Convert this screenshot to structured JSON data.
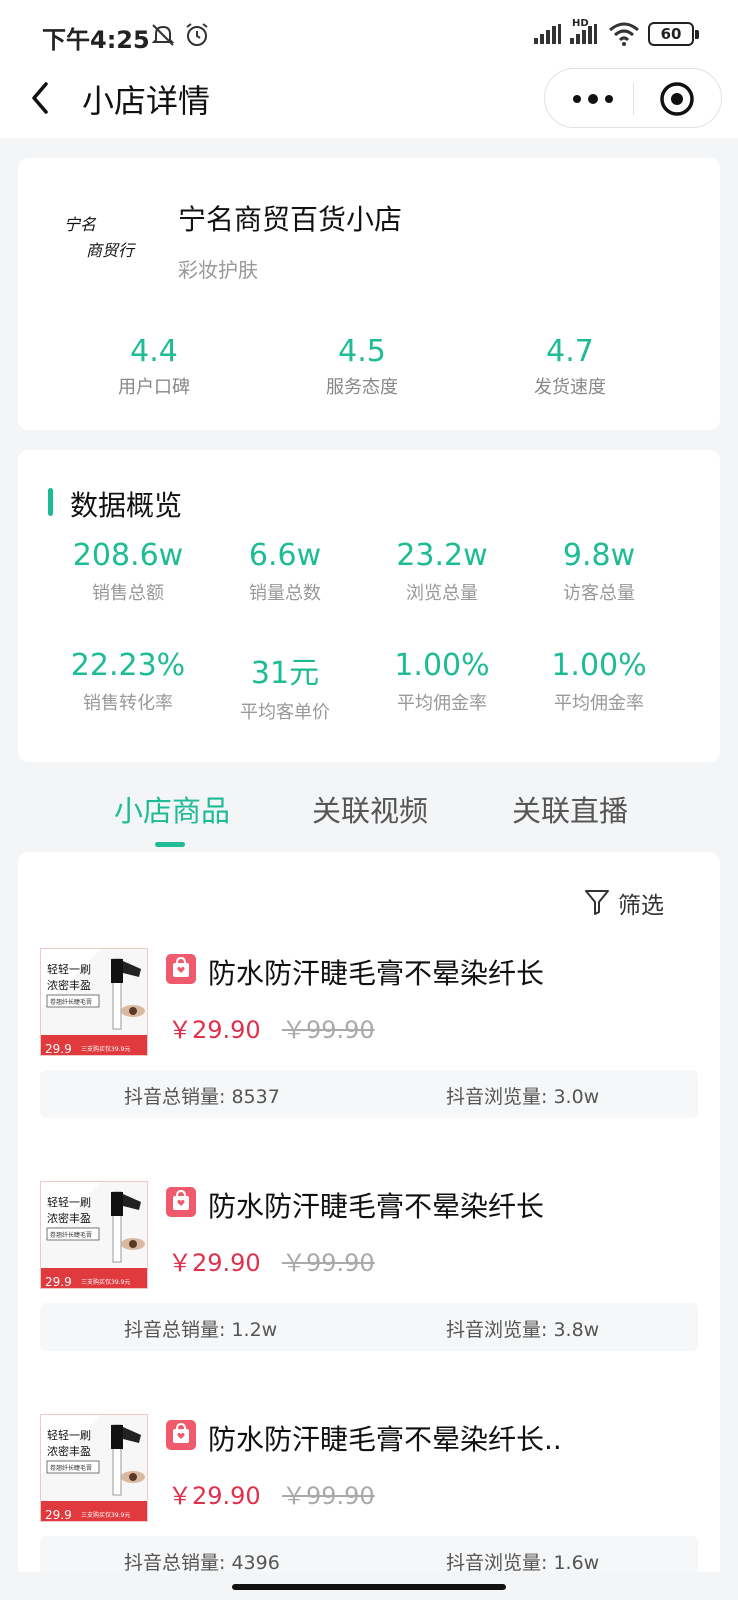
{
  "status_bar": {
    "time": "下午4:25",
    "hd": "HD",
    "battery": "60"
  },
  "nav": {
    "title": "小店详情"
  },
  "shop": {
    "logo_text": "宁名商贸行",
    "name": "宁名商贸百货小店",
    "category": "彩妆护肤",
    "scores": [
      {
        "value": "4.4",
        "label": "用户口碑"
      },
      {
        "value": "4.5",
        "label": "服务态度"
      },
      {
        "value": "4.7",
        "label": "发货速度"
      }
    ]
  },
  "overview": {
    "title": "数据概览",
    "stats": [
      {
        "value": "208.6w",
        "label": "销售总额"
      },
      {
        "value": "6.6w",
        "label": "销量总数"
      },
      {
        "value": "23.2w",
        "label": "浏览总量"
      },
      {
        "value": "9.8w",
        "label": "访客总量"
      },
      {
        "value": "22.23%",
        "label": "销售转化率"
      },
      {
        "value": "31元",
        "label": "平均客单价"
      },
      {
        "value": "1.00%",
        "label": "平均佣金率"
      },
      {
        "value": "1.00%",
        "label": "平均佣金率"
      }
    ]
  },
  "tabs": [
    "小店商品",
    "关联视频",
    "关联直播"
  ],
  "filter_label": "筛选",
  "thumb": {
    "line1": "轻轻一刷",
    "line2": "浓密丰盈",
    "line3": "卷翘纤长睫毛膏",
    "price_tag": "29.9",
    "promo": "三支购买仅39.9元"
  },
  "products": [
    {
      "title": "防水防汗睫毛膏不晕染纤长",
      "price": "￥29.90",
      "original_price": "￥99.90",
      "sales": "抖音总销量: 8537",
      "views": "抖音浏览量: 3.0w"
    },
    {
      "title": "防水防汗睫毛膏不晕染纤长",
      "price": "￥29.90",
      "original_price": "￥99.90",
      "sales": "抖音总销量: 1.2w",
      "views": "抖音浏览量: 3.8w"
    },
    {
      "title": "防水防汗睫毛膏不晕染纤长..",
      "price": "￥29.90",
      "original_price": "￥99.90",
      "sales": "抖音总销量: 4396",
      "views": "抖音浏览量: 1.6w"
    }
  ],
  "colors": {
    "accent": "#1ebc94",
    "price": "#e0304c",
    "shop_icon": "#ef5a6c"
  }
}
